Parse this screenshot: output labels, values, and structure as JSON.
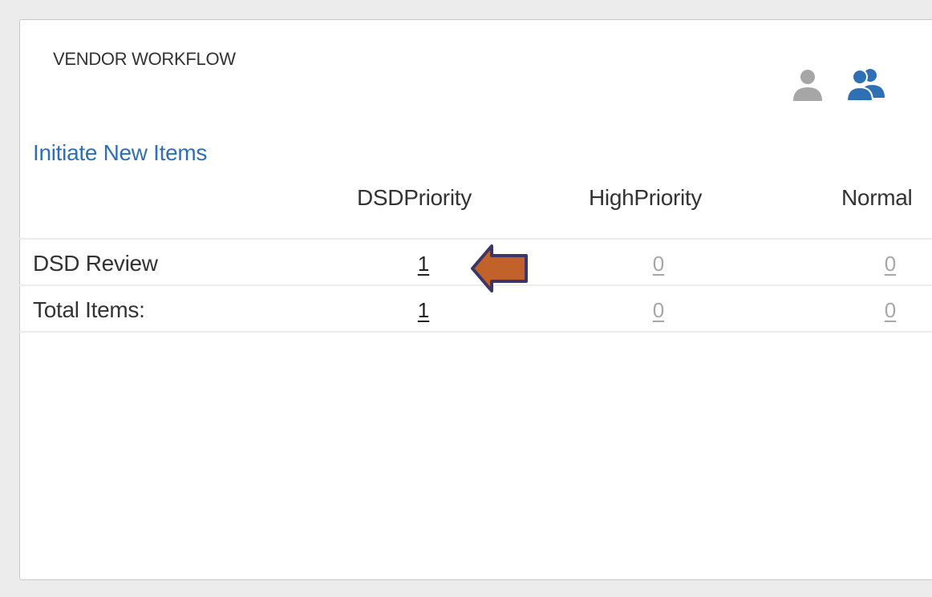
{
  "widget": {
    "title": "VENDOR WORKFLOW",
    "view_icons": [
      {
        "name": "single-user-icon",
        "color": "#a6a6a6"
      },
      {
        "name": "group-users-icon",
        "color": "#2f6fb3"
      }
    ],
    "initiate_link": "Initiate New Items"
  },
  "table": {
    "columns": [
      "DSDPriority",
      "HighPriority",
      "Normal"
    ],
    "rows": [
      {
        "label": "DSD Review",
        "values": [
          "1",
          "0",
          "0"
        ]
      },
      {
        "label": "Total Items:",
        "values": [
          "1",
          "0",
          "0"
        ]
      }
    ]
  },
  "annotation": {
    "arrow_color": "#c0622a",
    "arrow_border": "#3d3566",
    "direction": "left"
  }
}
